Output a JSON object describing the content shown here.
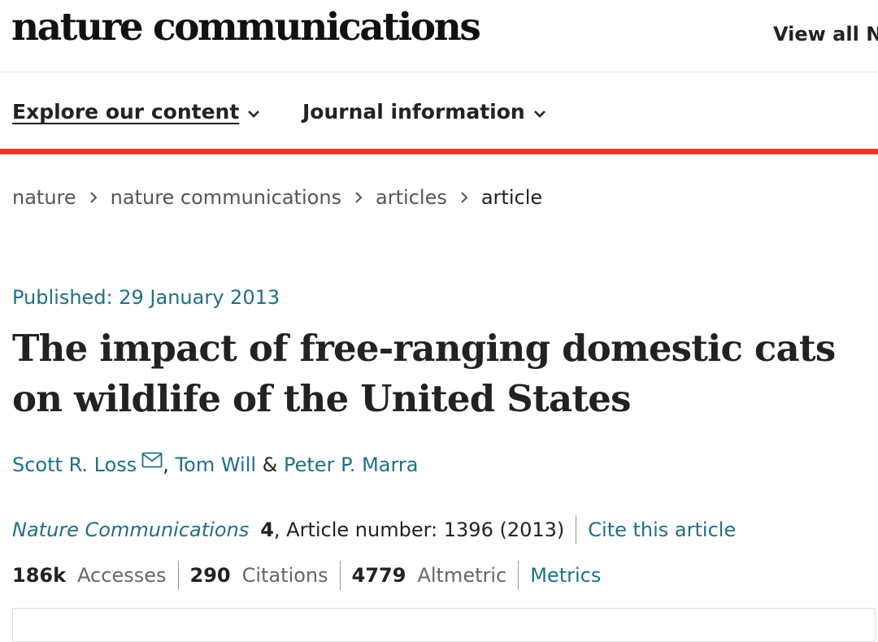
{
  "header": {
    "logo": "nature communications",
    "view_all": "View all N"
  },
  "nav": {
    "explore": "Explore our content",
    "journal_info": "Journal information"
  },
  "breadcrumb": {
    "items": [
      "nature",
      "nature communications",
      "articles"
    ],
    "current": "article"
  },
  "article": {
    "published": "Published: 29 January 2013",
    "title": "The impact of free-ranging domestic cats on wildlife of the United States",
    "authors": [
      "Scott R. Loss",
      "Tom Will",
      "Peter P. Marra"
    ],
    "author_sep_1": ", ",
    "author_sep_2": " & ",
    "journal": "Nature Communications",
    "volume": "4",
    "article_number": ", Article number: 1396 (2013)",
    "cite": "Cite this article"
  },
  "metrics": {
    "accesses_value": "186k",
    "accesses_label": "Accesses",
    "citations_value": "290",
    "citations_label": "Citations",
    "altmetric_value": "4779",
    "altmetric_label": "Altmetric",
    "metrics_link": "Metrics"
  },
  "colors": {
    "accent_red": "#e5392d",
    "link_blue": "#1f6f8b"
  }
}
